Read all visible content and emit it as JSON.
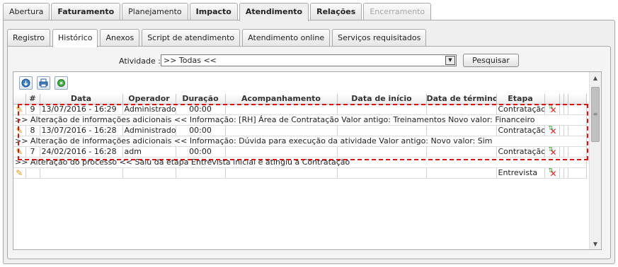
{
  "main_tabs": [
    {
      "label": "Abertura",
      "state": "normal"
    },
    {
      "label": "Faturamento",
      "state": "bold"
    },
    {
      "label": "Planejamento",
      "state": "normal"
    },
    {
      "label": "Impacto",
      "state": "bold"
    },
    {
      "label": "Atendimento",
      "state": "active"
    },
    {
      "label": "Relações",
      "state": "bold"
    },
    {
      "label": "Encerramento",
      "state": "disabled"
    }
  ],
  "sub_tabs": [
    {
      "label": "Registro"
    },
    {
      "label": "Histórico"
    },
    {
      "label": "Anexos"
    },
    {
      "label": "Script de atendimento"
    },
    {
      "label": "Atendimento online"
    },
    {
      "label": "Serviços requisitados"
    }
  ],
  "filter": {
    "label": "Atividade :",
    "selected": ">> Todas <<",
    "search_label": "Pesquisar"
  },
  "toolbar": {
    "icons": [
      "export-icon",
      "print-icon",
      "refresh-icon"
    ]
  },
  "columns": [
    "#",
    "Data",
    "Operador",
    "Duração",
    "Acompanhamento",
    "Data de início",
    "Data de término",
    "Etapa"
  ],
  "rows": [
    {
      "num": "9",
      "date": "13/07/2016 - 16:29",
      "operator": "Administrador",
      "duration": "00:00",
      "follow": "",
      "start": "",
      "end": "",
      "stage": "Contratação",
      "detail": ">> Alteração de informações adicionais <<\n\nInformação: [RH] Área de Contratação\nValor antigo: Treinamentos\nNovo valor: Financeiro"
    },
    {
      "num": "8",
      "date": "13/07/2016 - 16:28",
      "operator": "Administrador",
      "duration": "00:00",
      "follow": "",
      "start": "",
      "end": "",
      "stage": "Contratação",
      "detail": ">> Alteração de informações adicionais <<\n\nInformação: Dúvida para execução da atividade\nValor antigo:\nNovo valor: Sim"
    },
    {
      "num": "7",
      "date": "24/02/2016 - 16:28",
      "operator": "adm",
      "duration": "00:00",
      "follow": "",
      "start": "",
      "end": "",
      "stage": "Contratação",
      "detail": ">> Alteração do processo <<\nSaiu da etapa Entrevista inicial e atingiu a Contratação"
    },
    {
      "num": "",
      "date": "",
      "operator": "",
      "duration": "",
      "follow": "",
      "start": "",
      "end": "",
      "stage": "Entrevista",
      "detail": ""
    }
  ]
}
